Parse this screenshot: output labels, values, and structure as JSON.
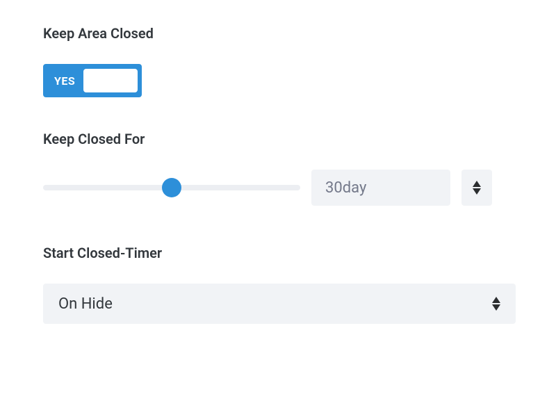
{
  "labels": {
    "keep_area_closed": "Keep Area Closed",
    "keep_closed_for": "Keep Closed For",
    "start_closed_timer": "Start Closed-Timer"
  },
  "toggle": {
    "state_label": "YES"
  },
  "keep_closed_for": {
    "value_display": "30day",
    "slider_fraction": 0.5
  },
  "start_closed_timer": {
    "selected": "On Hide"
  },
  "colors": {
    "accent": "#2d8fd9",
    "muted_bg": "#f1f3f6",
    "text": "#32373c",
    "text_muted": "#74798a"
  }
}
